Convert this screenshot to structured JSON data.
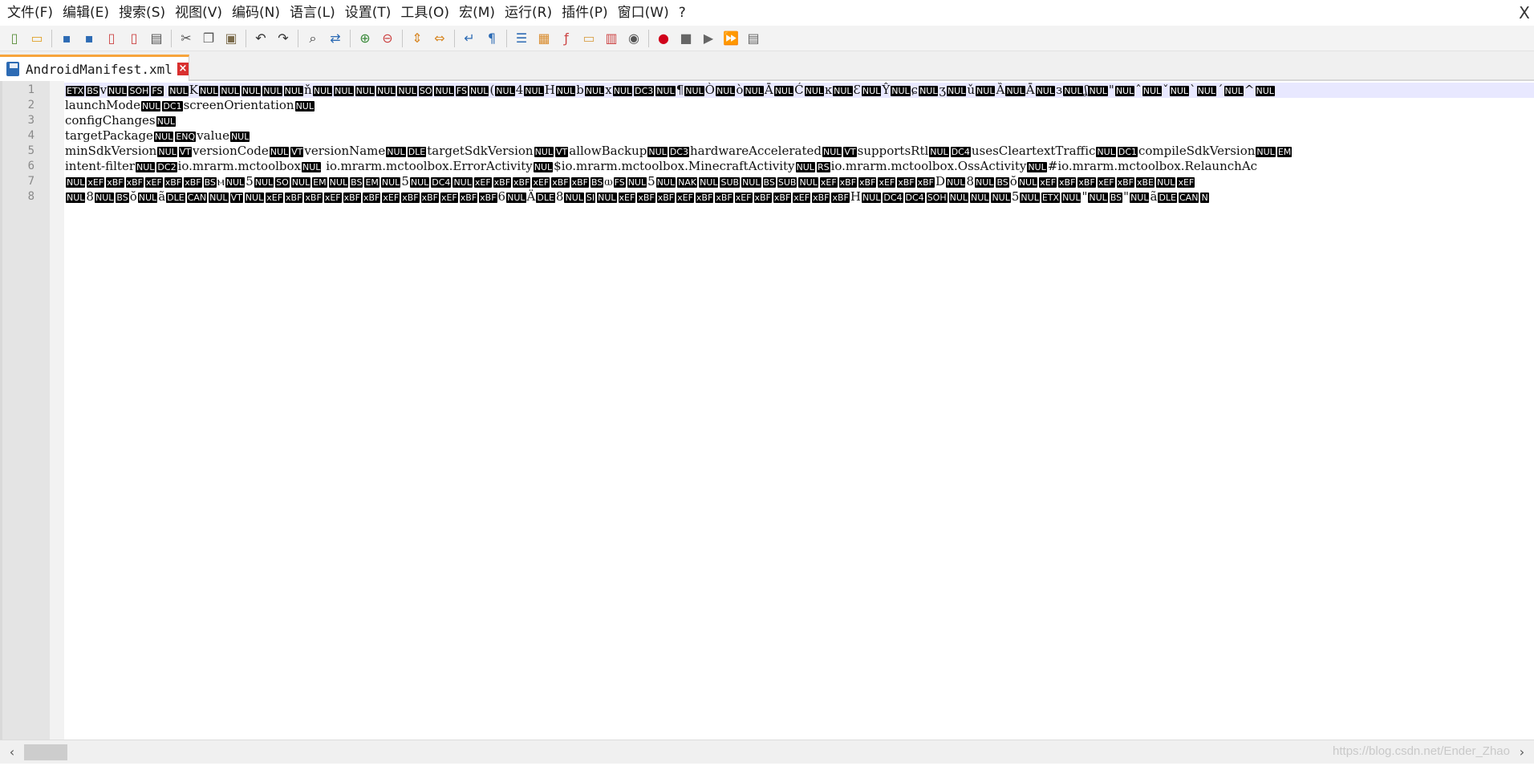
{
  "menubar": {
    "items": [
      "文件(F)",
      "编辑(E)",
      "搜索(S)",
      "视图(V)",
      "编码(N)",
      "语言(L)",
      "设置(T)",
      "工具(O)",
      "宏(M)",
      "运行(R)",
      "插件(P)",
      "窗口(W)",
      "?"
    ],
    "close_label": "X"
  },
  "toolbar": {
    "buttons": [
      "new-file-icon",
      "open-file-icon",
      "save-icon",
      "save-all-icon",
      "close-icon",
      "close-all-icon",
      "print-icon",
      "cut-icon",
      "copy-icon",
      "paste-icon",
      "undo-icon",
      "redo-icon",
      "find-icon",
      "replace-icon",
      "zoom-in-icon",
      "zoom-out-icon",
      "sync-vertical-icon",
      "sync-horizontal-icon",
      "word-wrap-icon",
      "show-all-chars-icon",
      "indent-guide-icon",
      "doc-map-icon",
      "function-list-icon",
      "folder-workspace-icon",
      "doc-list-icon",
      "monitoring-icon",
      "macro-record-icon",
      "macro-stop-icon",
      "macro-play-icon",
      "macro-run-multiple-icon",
      "macro-save-icon"
    ]
  },
  "tab": {
    "label": "AndroidManifest.xml"
  },
  "editor": {
    "line_numbers": [
      "1",
      "2",
      "3",
      "4",
      "5",
      "6",
      "7",
      "8"
    ],
    "lines": [
      [
        [
          "c",
          "ETX"
        ],
        [
          "c",
          "BS"
        ],
        [
          "t",
          "v"
        ],
        [
          "c",
          "NUL"
        ],
        [
          "c",
          "SOH"
        ],
        [
          "c",
          "FS"
        ],
        [
          "t",
          " "
        ],
        [
          "c",
          "NUL"
        ],
        [
          "t",
          "K"
        ],
        [
          "c",
          "NUL"
        ],
        [
          "c",
          "NUL"
        ],
        [
          "c",
          "NUL"
        ],
        [
          "c",
          "NUL"
        ],
        [
          "c",
          "NUL"
        ],
        [
          "t",
          "ň"
        ],
        [
          "c",
          "NUL"
        ],
        [
          "c",
          "NUL"
        ],
        [
          "c",
          "NUL"
        ],
        [
          "c",
          "NUL"
        ],
        [
          "c",
          "NUL"
        ],
        [
          "c",
          "SO"
        ],
        [
          "c",
          "NUL"
        ],
        [
          "c",
          "FS"
        ],
        [
          "c",
          "NUL"
        ],
        [
          "t",
          "("
        ],
        [
          "c",
          "NUL"
        ],
        [
          "t",
          "4"
        ],
        [
          "c",
          "NUL"
        ],
        [
          "t",
          "H"
        ],
        [
          "c",
          "NUL"
        ],
        [
          "t",
          "b"
        ],
        [
          "c",
          "NUL"
        ],
        [
          "t",
          "x"
        ],
        [
          "c",
          "NUL"
        ],
        [
          "c",
          "DC3"
        ],
        [
          "c",
          "NUL"
        ],
        [
          "t",
          "¶"
        ],
        [
          "c",
          "NUL"
        ],
        [
          "t",
          "Ò"
        ],
        [
          "c",
          "NUL"
        ],
        [
          "t",
          "ò"
        ],
        [
          "c",
          "NUL"
        ],
        [
          "t",
          "Ā"
        ],
        [
          "c",
          "NUL"
        ],
        [
          "t",
          "Ć"
        ],
        [
          "c",
          "NUL"
        ],
        [
          "t",
          "ĸ"
        ],
        [
          "c",
          "NUL"
        ],
        [
          "t",
          "Ɛ"
        ],
        [
          "c",
          "NUL"
        ],
        [
          "t",
          "Ŷ"
        ],
        [
          "c",
          "NUL"
        ],
        [
          "t",
          "ɕ"
        ],
        [
          "c",
          "NUL"
        ],
        [
          "t",
          "ʒ"
        ],
        [
          "c",
          "NUL"
        ],
        [
          "t",
          "ǔ"
        ],
        [
          "c",
          "NUL"
        ],
        [
          "t",
          "Ȁ"
        ],
        [
          "c",
          "NUL"
        ],
        [
          "t",
          "Ā"
        ],
        [
          "c",
          "NUL"
        ],
        [
          "t",
          "з"
        ],
        [
          "c",
          "NUL"
        ],
        [
          "t",
          "ʆ"
        ],
        [
          "c",
          "NUL"
        ],
        [
          "t",
          "\""
        ],
        [
          "c",
          "NUL"
        ],
        [
          "t",
          "ˆ"
        ],
        [
          "c",
          "NUL"
        ],
        [
          "t",
          "ˇ"
        ],
        [
          "c",
          "NUL"
        ],
        [
          "t",
          "ˋ"
        ],
        [
          "c",
          "NUL"
        ],
        [
          "t",
          "ˊ"
        ],
        [
          "c",
          "NUL"
        ],
        [
          "t",
          "^"
        ],
        [
          "c",
          "NUL"
        ]
      ],
      [
        [
          "t",
          "launchMode"
        ],
        [
          "c",
          "NUL"
        ],
        [
          "c",
          "DC1"
        ],
        [
          "t",
          "screenOrientation"
        ],
        [
          "c",
          "NUL"
        ]
      ],
      [
        [
          "t",
          "configChanges"
        ],
        [
          "c",
          "NUL"
        ]
      ],
      [
        [
          "t",
          "targetPackage"
        ],
        [
          "c",
          "NUL"
        ],
        [
          "c",
          "ENQ"
        ],
        [
          "t",
          "value"
        ],
        [
          "c",
          "NUL"
        ]
      ],
      [
        [
          "t",
          "minSdkVersion"
        ],
        [
          "c",
          "NUL"
        ],
        [
          "c",
          "VT"
        ],
        [
          "t",
          "versionCode"
        ],
        [
          "c",
          "NUL"
        ],
        [
          "c",
          "VT"
        ],
        [
          "t",
          "versionName"
        ],
        [
          "c",
          "NUL"
        ],
        [
          "c",
          "DLE"
        ],
        [
          "t",
          "targetSdkVersion"
        ],
        [
          "c",
          "NUL"
        ],
        [
          "c",
          "VT"
        ],
        [
          "t",
          "allowBackup"
        ],
        [
          "c",
          "NUL"
        ],
        [
          "c",
          "DC3"
        ],
        [
          "t",
          "hardwareAccelerated"
        ],
        [
          "c",
          "NUL"
        ],
        [
          "c",
          "VT"
        ],
        [
          "t",
          "supportsRtl"
        ],
        [
          "c",
          "NUL"
        ],
        [
          "c",
          "DC4"
        ],
        [
          "t",
          "usesCleartextTraffic"
        ],
        [
          "c",
          "NUL"
        ],
        [
          "c",
          "DC1"
        ],
        [
          "t",
          "compileSdkVersion"
        ],
        [
          "c",
          "NUL"
        ],
        [
          "c",
          "EM"
        ]
      ],
      [
        [
          "t",
          "intent-filter"
        ],
        [
          "c",
          "NUL"
        ],
        [
          "c",
          "DC2"
        ],
        [
          "t",
          "io.mrarm.mctoolbox"
        ],
        [
          "c",
          "NUL"
        ],
        [
          "t",
          " io.mrarm.mctoolbox.ErrorActivity"
        ],
        [
          "c",
          "NUL"
        ],
        [
          "t",
          "$io.mrarm.mctoolbox.MinecraftActivity"
        ],
        [
          "c",
          "NUL"
        ],
        [
          "c",
          "RS"
        ],
        [
          "t",
          "io.mrarm.mctoolbox.OssActivity"
        ],
        [
          "c",
          "NUL"
        ],
        [
          "t",
          "#io.mrarm.mctoolbox.RelaunchAc"
        ]
      ],
      [
        [
          "c",
          "NUL"
        ],
        [
          "c",
          "xEF"
        ],
        [
          "c",
          "xBF"
        ],
        [
          "c",
          "xBF"
        ],
        [
          "c",
          "xEF"
        ],
        [
          "c",
          "xBF"
        ],
        [
          "c",
          "xBF"
        ],
        [
          "c",
          "BS"
        ],
        [
          "t",
          "ⲙ"
        ],
        [
          "c",
          "NUL"
        ],
        [
          "t",
          "5"
        ],
        [
          "c",
          "NUL"
        ],
        [
          "c",
          "SO"
        ],
        [
          "c",
          "NUL"
        ],
        [
          "c",
          "EM"
        ],
        [
          "c",
          "NUL"
        ],
        [
          "c",
          "BS"
        ],
        [
          "c",
          "EM"
        ],
        [
          "c",
          "NUL"
        ],
        [
          "t",
          "5"
        ],
        [
          "c",
          "NUL"
        ],
        [
          "c",
          "DC4"
        ],
        [
          "c",
          "NUL"
        ],
        [
          "c",
          "xEF"
        ],
        [
          "c",
          "xBF"
        ],
        [
          "c",
          "xBF"
        ],
        [
          "c",
          "xEF"
        ],
        [
          "c",
          "xBF"
        ],
        [
          "c",
          "xBF"
        ],
        [
          "c",
          "BS"
        ],
        [
          "t",
          "ⲱ"
        ],
        [
          "c",
          "FS"
        ],
        [
          "c",
          "NUL"
        ],
        [
          "t",
          "5"
        ],
        [
          "c",
          "NUL"
        ],
        [
          "c",
          "NAK"
        ],
        [
          "c",
          "NUL"
        ],
        [
          "c",
          "SUB"
        ],
        [
          "c",
          "NUL"
        ],
        [
          "c",
          "BS"
        ],
        [
          "c",
          "SUB"
        ],
        [
          "c",
          "NUL"
        ],
        [
          "c",
          "xEF"
        ],
        [
          "c",
          "xBF"
        ],
        [
          "c",
          "xBF"
        ],
        [
          "c",
          "xEF"
        ],
        [
          "c",
          "xBF"
        ],
        [
          "c",
          "xBF"
        ],
        [
          "t",
          "D"
        ],
        [
          "c",
          "NUL"
        ],
        [
          "t",
          "8"
        ],
        [
          "c",
          "NUL"
        ],
        [
          "c",
          "BS"
        ],
        [
          "t",
          "ŏ"
        ],
        [
          "c",
          "NUL"
        ],
        [
          "c",
          "xEF"
        ],
        [
          "c",
          "xBF"
        ],
        [
          "c",
          "xBF"
        ],
        [
          "c",
          "xEF"
        ],
        [
          "c",
          "xBF"
        ],
        [
          "c",
          "xBE"
        ],
        [
          "c",
          "NUL"
        ],
        [
          "c",
          "xEF"
        ]
      ],
      [
        [
          "c",
          "NUL"
        ],
        [
          "t",
          "8"
        ],
        [
          "c",
          "NUL"
        ],
        [
          "c",
          "BS"
        ],
        [
          "t",
          "ŏ"
        ],
        [
          "c",
          "NUL"
        ],
        [
          "t",
          "ã"
        ],
        [
          "c",
          "DLE"
        ],
        [
          "c",
          "CAN"
        ],
        [
          "c",
          "NUL"
        ],
        [
          "c",
          "VT"
        ],
        [
          "c",
          "NUL"
        ],
        [
          "c",
          "xEF"
        ],
        [
          "c",
          "xBF"
        ],
        [
          "c",
          "xBF"
        ],
        [
          "c",
          "xEF"
        ],
        [
          "c",
          "xBF"
        ],
        [
          "c",
          "xBF"
        ],
        [
          "c",
          "xEF"
        ],
        [
          "c",
          "xBF"
        ],
        [
          "c",
          "xBF"
        ],
        [
          "c",
          "xEF"
        ],
        [
          "c",
          "xBF"
        ],
        [
          "c",
          "xBF"
        ],
        [
          "t",
          "6"
        ],
        [
          "c",
          "NUL"
        ],
        [
          "t",
          "Ä"
        ],
        [
          "c",
          "DLE"
        ],
        [
          "t",
          "8"
        ],
        [
          "c",
          "NUL"
        ],
        [
          "c",
          "SI"
        ],
        [
          "c",
          "NUL"
        ],
        [
          "c",
          "xEF"
        ],
        [
          "c",
          "xBF"
        ],
        [
          "c",
          "xBF"
        ],
        [
          "c",
          "xEF"
        ],
        [
          "c",
          "xBF"
        ],
        [
          "c",
          "xBF"
        ],
        [
          "c",
          "xEF"
        ],
        [
          "c",
          "xBF"
        ],
        [
          "c",
          "xBF"
        ],
        [
          "c",
          "xEF"
        ],
        [
          "c",
          "xBF"
        ],
        [
          "c",
          "xBF"
        ],
        [
          "t",
          "H"
        ],
        [
          "c",
          "NUL"
        ],
        [
          "c",
          "DC4"
        ],
        [
          "c",
          "DC4"
        ],
        [
          "c",
          "SOH"
        ],
        [
          "c",
          "NUL"
        ],
        [
          "c",
          "NUL"
        ],
        [
          "c",
          "NUL"
        ],
        [
          "t",
          "5"
        ],
        [
          "c",
          "NUL"
        ],
        [
          "c",
          "ETX"
        ],
        [
          "c",
          "NUL"
        ],
        [
          "t",
          "\""
        ],
        [
          "c",
          "NUL"
        ],
        [
          "c",
          "BS"
        ],
        [
          "t",
          "\""
        ],
        [
          "c",
          "NUL"
        ],
        [
          "t",
          "ã"
        ],
        [
          "c",
          "DLE"
        ],
        [
          "c",
          "CAN"
        ],
        [
          "c",
          "N"
        ]
      ]
    ]
  },
  "watermark": "https://blog.csdn.net/Ender_Zhao",
  "colors": {
    "tab_accent": "#f7a43c",
    "control_char_bg": "#000000",
    "current_line_bg": "#e8e8ff"
  }
}
